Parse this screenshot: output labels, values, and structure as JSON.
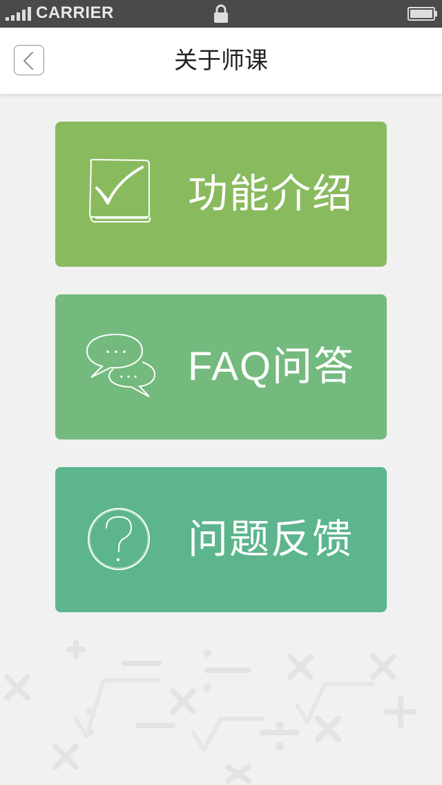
{
  "status_bar": {
    "carrier": "CARRIER"
  },
  "navbar": {
    "title": "关于师课"
  },
  "menu": {
    "items": [
      {
        "label": "功能介绍",
        "icon": "checklist-icon",
        "color": "#8aba5e"
      },
      {
        "label": "FAQ问答",
        "icon": "chat-bubbles-icon",
        "color": "#74ba7e"
      },
      {
        "label": "问题反馈",
        "icon": "question-icon",
        "color": "#5cb58d"
      }
    ]
  },
  "colors": {
    "status_bar_bg": "#4a4a4a",
    "navbar_bg": "#ffffff",
    "page_bg": "#f1f1f1"
  }
}
